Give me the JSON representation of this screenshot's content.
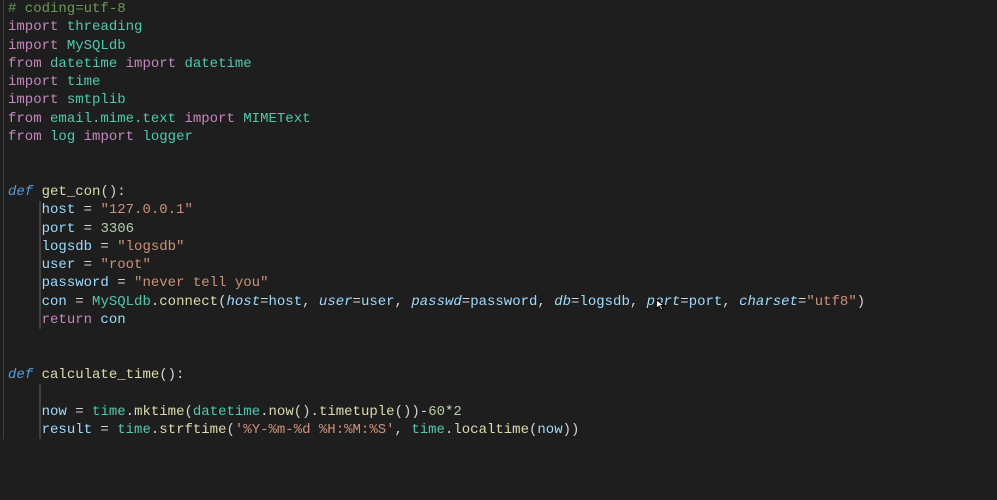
{
  "code": {
    "comment_coding": "# coding=utf-8",
    "kw_import1": "import",
    "mod_threading": "threading",
    "kw_import2": "import",
    "mod_mysqldb": "MySQLdb",
    "kw_from1": "from",
    "mod_datetime1": "datetime",
    "kw_import3": "import",
    "mod_datetime2": "datetime",
    "kw_import4": "import",
    "mod_time": "time",
    "kw_import5": "import",
    "mod_smtplib": "smtplib",
    "kw_from2": "from",
    "mod_email_mime_text": "email.mime.text",
    "kw_import6": "import",
    "mod_mimetext": "MIMEText",
    "kw_from3": "from",
    "mod_log": "log",
    "kw_import7": "import",
    "mod_logger": "logger",
    "kw_def1": "def",
    "fn_get_con": "get_con",
    "sig_get_con_open": "(",
    "sig_get_con_close": "):",
    "v_host": "host",
    "eq1": " = ",
    "s_host": "\"127.0.0.1\"",
    "v_port": "port",
    "eq2": " = ",
    "n_port": "3306",
    "v_logsdb": "logsdb",
    "eq3": " = ",
    "s_logsdb": "\"logsdb\"",
    "v_user": "user",
    "eq4": " = ",
    "s_user": "\"root\"",
    "v_password": "password",
    "eq5": " = ",
    "s_password": "\"never tell you\"",
    "v_con": "con",
    "eq6": " = ",
    "cls_mysqldb": "MySQLdb",
    "dot1": ".",
    "fn_connect": "connect",
    "p_open1": "(",
    "p_host": "host",
    "eqp1": "=",
    "a_host": "host",
    "comma1": ", ",
    "p_user": "user",
    "eqp2": "=",
    "a_user": "user",
    "comma2": ", ",
    "p_passwd": "passwd",
    "eqp3": "=",
    "a_password": "password",
    "comma3": ", ",
    "p_db": "db",
    "eqp4": "=",
    "a_logsdb": "logsdb",
    "comma4": ", ",
    "p_port": "port",
    "eqp5": "=",
    "a_port": "port",
    "comma5": ", ",
    "p_charset": "charset",
    "eqp6": "=",
    "s_charset": "\"utf8\"",
    "p_close1": ")",
    "kw_return1": "return",
    "r_con": " con",
    "kw_def2": "def",
    "fn_calculate_time": "calculate_time",
    "sig_calc_open": "(",
    "sig_calc_close": "):",
    "v_now": "now",
    "eq7": " = ",
    "m_time1": "time",
    "dot2": ".",
    "fn_mktime": "mktime",
    "p_open2": "(",
    "m_datetime": "datetime",
    "dot3": ".",
    "fn_now": "now",
    "paren_now": "()",
    "dot4": ".",
    "fn_timetuple": "timetuple",
    "paren_tt": "()",
    "p_close2": ")",
    "minus": "-",
    "n_60": "60",
    "star": "*",
    "n_2": "2",
    "v_result": "result",
    "eq8": " = ",
    "m_time2": "time",
    "dot5": ".",
    "fn_strftime": "strftime",
    "p_open3": "(",
    "s_fmt": "'%Y-%m-%d %H:%M:%S'",
    "comma6": ", ",
    "m_time3": "time",
    "dot6": ".",
    "fn_localtime": "localtime",
    "p_open4": "(",
    "a_now": "now",
    "p_close4": "))"
  },
  "cursor_glyph": "▷"
}
